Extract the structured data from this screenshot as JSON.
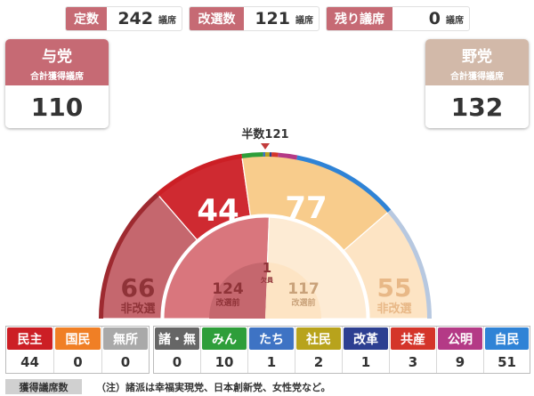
{
  "header": {
    "total": {
      "label": "定数",
      "value": "242",
      "unit": "議席"
    },
    "contested": {
      "label": "改選数",
      "value": "121",
      "unit": "議席"
    },
    "remaining": {
      "label": "残り議席",
      "value": "0",
      "unit": "議席"
    }
  },
  "ruling": {
    "name": "与党",
    "sub": "合計獲得議席",
    "count": "110"
  },
  "opposition": {
    "name": "野党",
    "sub": "合計獲得議席",
    "count": "132"
  },
  "chart_data": {
    "majority": {
      "label": "半数121",
      "value": 121
    },
    "outer": {
      "ruling_uncontested": {
        "value": "66",
        "label": "非改選"
      },
      "ruling_won": {
        "value": "44"
      },
      "opposition_won": {
        "value": "77"
      },
      "opposition_uncontested": {
        "value": "55",
        "label": "非改選"
      }
    },
    "inner": {
      "ruling_before": {
        "value": "124",
        "label": "改選前"
      },
      "opposition_before": {
        "value": "117",
        "label": "改選前"
      },
      "vacancy": {
        "value": "1",
        "label": "欠員"
      }
    },
    "colors": {
      "ruling_uncontested": "#c5676e",
      "ruling_won": "#cf2a31",
      "opposition_won": "#f8cc8c",
      "opposition_uncontested": "#fde4c4",
      "ruling_inner": "#d9767d",
      "opposition_inner": "#fdebd4"
    }
  },
  "ruling_parties": [
    {
      "name": "民主",
      "seats": "44",
      "color": "#cc1f25"
    },
    {
      "name": "国民",
      "seats": "0",
      "color": "#f07f25"
    },
    {
      "name": "無所",
      "seats": "0",
      "color": "#a9a9a9"
    }
  ],
  "opposition_parties": [
    {
      "name": "諸・無",
      "seats": "0",
      "color": "#666666"
    },
    {
      "name": "みん",
      "seats": "10",
      "color": "#2e9e3a"
    },
    {
      "name": "たち",
      "seats": "1",
      "color": "#3e73c4"
    },
    {
      "name": "社民",
      "seats": "2",
      "color": "#b8a31c"
    },
    {
      "name": "改革",
      "seats": "1",
      "color": "#2c3f91"
    },
    {
      "name": "共産",
      "seats": "3",
      "color": "#d4352a"
    },
    {
      "name": "公明",
      "seats": "9",
      "color": "#b43a86"
    },
    {
      "name": "自民",
      "seats": "51",
      "color": "#2f83d6"
    }
  ],
  "footer": {
    "legend": "獲得議席数",
    "note": "（注）諸派は幸福実現党、日本創新党、女性党など。"
  }
}
